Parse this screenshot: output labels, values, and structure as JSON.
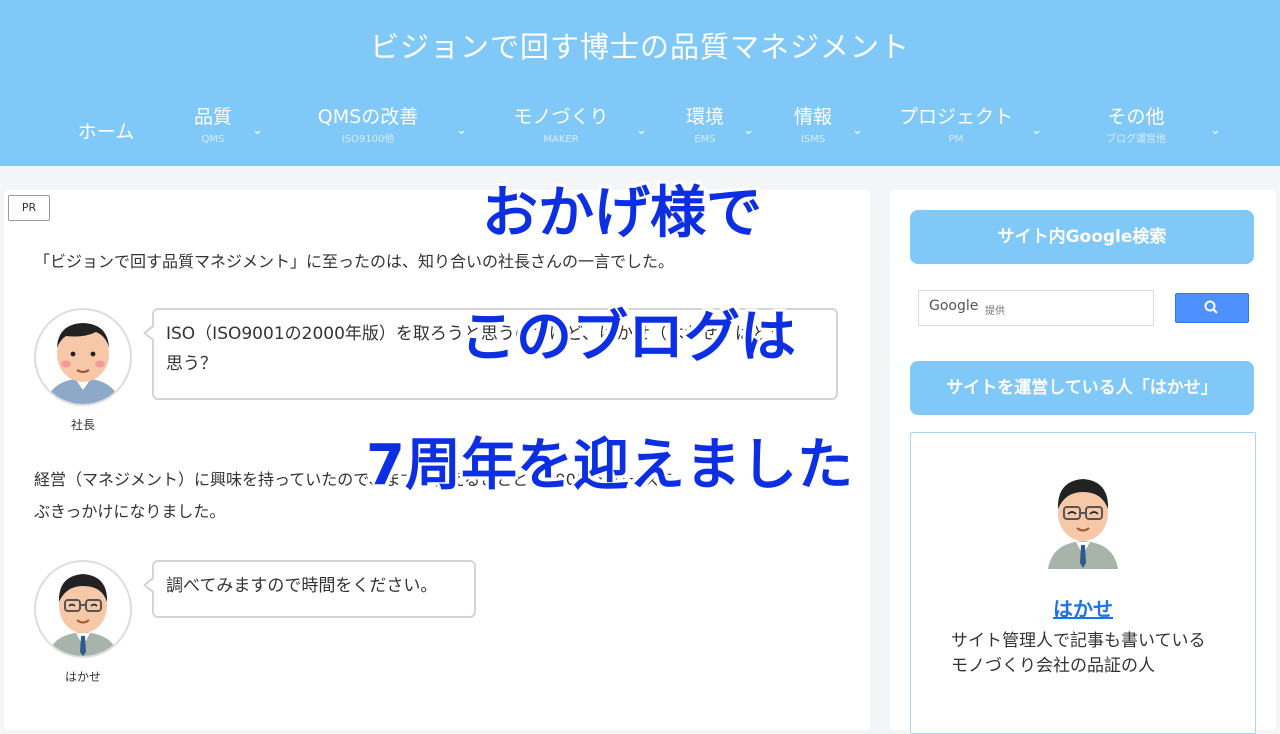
{
  "site": {
    "title": "ビジョンで回す博士の品質マネジメント"
  },
  "nav": {
    "items": [
      {
        "label": "ホーム",
        "sub": ""
      },
      {
        "label": "品質",
        "sub": "QMS"
      },
      {
        "label": "QMSの改善",
        "sub": "ISO9100他"
      },
      {
        "label": "モノづくり",
        "sub": "MAKER"
      },
      {
        "label": "環境",
        "sub": "EMS"
      },
      {
        "label": "情報",
        "sub": "ISMS"
      },
      {
        "label": "プロジェクト",
        "sub": "PM"
      },
      {
        "label": "その他",
        "sub": "ブログ運営他"
      }
    ],
    "chevron": "⌄"
  },
  "main": {
    "pr_badge": "PR",
    "intro": "「ビジョンで回す品質マネジメント」に至ったのは、知り合いの社長さんの一言でした。",
    "speech1": {
      "speaker": "社長",
      "text_line1": "ISO（ISO9001の2000年版）を取ろうと思うのだけど、はかせ（はかせ）はどう",
      "text_line2": "思う？"
    },
    "para2_line1": "経営（マネジメント）に興味を持っていたので、まずは答えることとISO9000シリーズを",
    "para2_line2": "ぶきっかけになりました。",
    "speech2": {
      "speaker": "はかせ",
      "text": "調べてみますので時間をください。"
    }
  },
  "sidebar": {
    "search_heading": "サイト内Google検索",
    "google_label": "Google",
    "google_sub": "提供",
    "search_icon": "search-icon",
    "about_heading": "サイトを運営している人「はかせ」",
    "profile_name": "はかせ",
    "profile_desc": "サイト管理人で記事も書いているモノづくり会社の品証の人"
  },
  "overlay": {
    "line1": "おかげ様で",
    "line2": "このブログは",
    "line3": "7周年を迎えました"
  },
  "colors": {
    "header": "#80c8f8",
    "overlay_text": "#0c2fe3",
    "link": "#1a73e8"
  }
}
